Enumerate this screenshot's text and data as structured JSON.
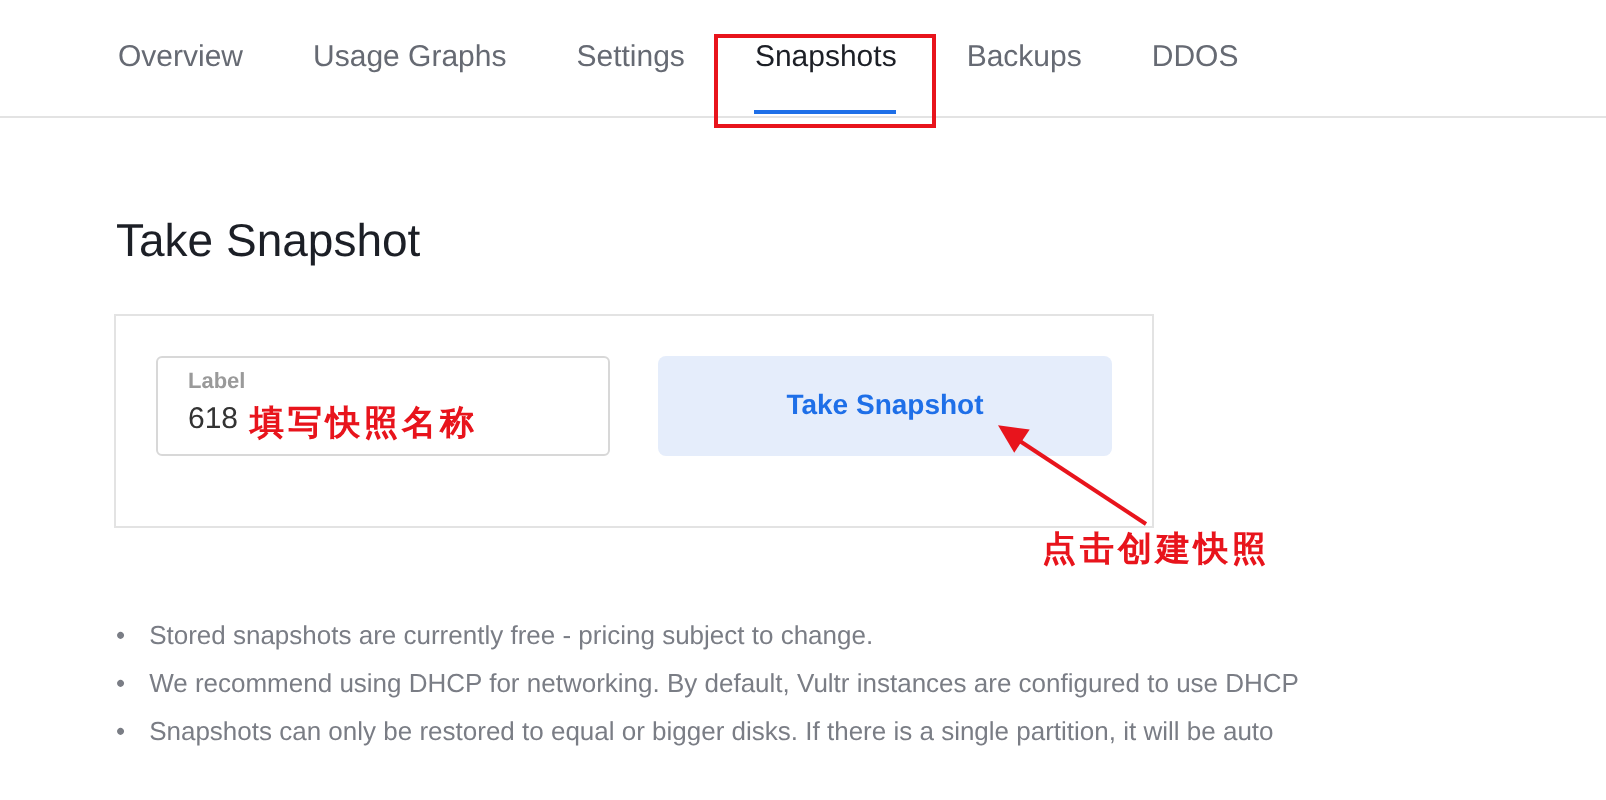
{
  "tabs": [
    {
      "label": "Overview",
      "selected": false
    },
    {
      "label": "Usage Graphs",
      "selected": false
    },
    {
      "label": "Settings",
      "selected": false
    },
    {
      "label": "Snapshots",
      "selected": true
    },
    {
      "label": "Backups",
      "selected": false
    },
    {
      "label": "DDOS",
      "selected": false
    }
  ],
  "heading": "Take Snapshot",
  "form": {
    "label_field": {
      "label": "Label",
      "value": "618"
    },
    "button": "Take Snapshot"
  },
  "notes": [
    {
      "bullet": "•",
      "text": "Stored snapshots are currently free - pricing subject to change."
    },
    {
      "bullet": "•",
      "text": "We recommend using DHCP for networking. By default, Vultr instances are configured to use DHCP"
    },
    {
      "bullet": "•",
      "text": "Snapshots can only be restored to equal or bigger disks. If there is a single partition, it will be auto"
    }
  ],
  "annotations": [
    {
      "kind": "highlight-box"
    },
    {
      "kind": "note",
      "text": "填写快照名称"
    },
    {
      "kind": "arrow-note",
      "text": "点击创建快照"
    }
  ]
}
